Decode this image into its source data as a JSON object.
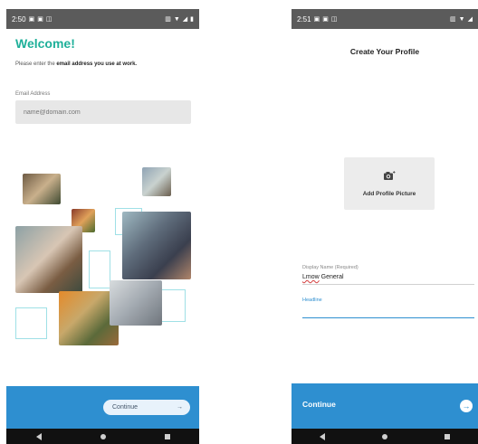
{
  "left_screen": {
    "status": {
      "time": "2:50",
      "icons_left": [
        "notification-icon",
        "notification-icon",
        "message-icon"
      ],
      "icons_right": [
        "vibrate-icon",
        "wifi-icon",
        "signal-icon",
        "battery-icon"
      ]
    },
    "title": "Welcome!",
    "subtitle_prefix": "Please enter the ",
    "subtitle_bold": "email address you use at work.",
    "email_label": "Email Address",
    "email_placeholder": "name@domain.com",
    "continue_label": "Continue",
    "continue_arrow": "→"
  },
  "right_screen": {
    "status": {
      "time": "2:51",
      "icons_left": [
        "notification-icon",
        "notification-icon",
        "message-icon"
      ],
      "icons_right": [
        "vibrate-icon",
        "wifi-icon",
        "signal-icon"
      ]
    },
    "title": "Create Your Profile",
    "add_picture_label": "Add Profile Picture",
    "display_name_label": "Display Name (Required)",
    "display_name_first": "Lmow",
    "display_name_second": " General",
    "headline_label": "Headline",
    "continue_label": "Continue",
    "continue_arrow": "→"
  },
  "colors": {
    "accent_green": "#1fb09a",
    "footer_blue": "#2e8fd0",
    "status_gray": "#5b5b5b"
  }
}
